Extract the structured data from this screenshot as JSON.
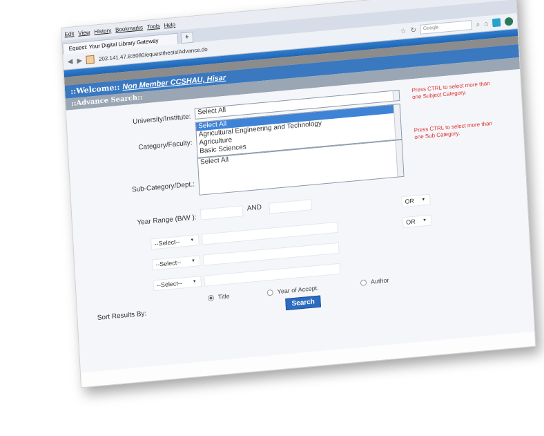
{
  "browser": {
    "menu": [
      "Edit",
      "View",
      "History",
      "Bookmarks",
      "Tools",
      "Help"
    ],
    "tab_title": "Equest: Your Digital Library Gateway",
    "new_tab": "+",
    "url": "202.141.47.8:8080/equestthesis/Advance.do",
    "search_placeholder": "Google"
  },
  "header": {
    "welcome_prefix": "::Welcome:: ",
    "welcome_name": "Non Member CCSHAU, Hisar",
    "advance_search": "::Advance Search::"
  },
  "form": {
    "university_label": "University/Institute:",
    "university_options": [
      "Select All"
    ],
    "university_hint": "Press CTRL to select more than one Subject Category.",
    "category_label": "Category/Faculty:",
    "category_options": [
      "Select All",
      "Agricultural Engineering and Technology",
      "Agriculture",
      "Basic Sciences"
    ],
    "subcategory_label": "Sub-Category/Dept.:",
    "subcategory_options": [
      "Select All"
    ],
    "subcategory_hint": "Press CTRL to select more than one Sub Category.",
    "year_label": "Year Range (B/W ):",
    "and_label": "AND",
    "field_select": "--Select--",
    "or_label": "OR",
    "sort_label": "Sort Results By:",
    "sort_options": [
      "Title",
      "Year of Accept.",
      "Author"
    ],
    "search_button": "Search"
  }
}
